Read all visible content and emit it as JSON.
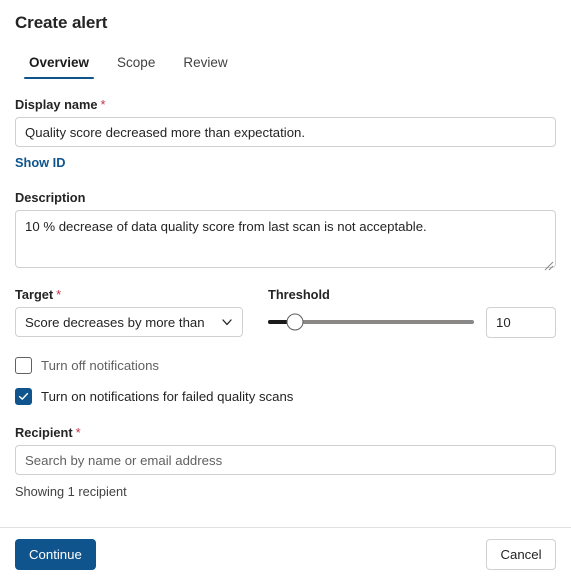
{
  "panel": {
    "title": "Create alert"
  },
  "tabs": [
    {
      "label": "Overview",
      "active": true
    },
    {
      "label": "Scope",
      "active": false
    },
    {
      "label": "Review",
      "active": false
    }
  ],
  "fields": {
    "display_name": {
      "label": "Display name",
      "required_marker": "*",
      "value": "Quality score decreased more than expectation.",
      "placeholder": ""
    },
    "show_id_link": "Show ID",
    "description": {
      "label": "Description",
      "value": "10 % decrease of data quality score from last scan is not acceptable.",
      "placeholder": ""
    },
    "target": {
      "label": "Target",
      "required_marker": "*",
      "selected": "Score decreases by more than",
      "options": [
        "Score decreases by more than"
      ]
    },
    "threshold": {
      "label": "Threshold",
      "slider_value": 10,
      "slider_min": 0,
      "slider_max": 100,
      "number_value": "10"
    },
    "recipient": {
      "label": "Recipient",
      "required_marker": "*",
      "value": "",
      "placeholder": "Search by name or email address",
      "helper": "Showing 1 recipient"
    }
  },
  "checkboxes": [
    {
      "label": "Turn off notifications",
      "checked": false
    },
    {
      "label": "Turn on notifications for failed quality scans",
      "checked": true
    }
  ],
  "footer": {
    "continue_label": "Continue",
    "cancel_label": "Cancel"
  },
  "colors": {
    "accent": "#0f548c",
    "required": "#c4314b",
    "border": "#d1d1d1",
    "text": "#242424",
    "muted": "#616161"
  }
}
